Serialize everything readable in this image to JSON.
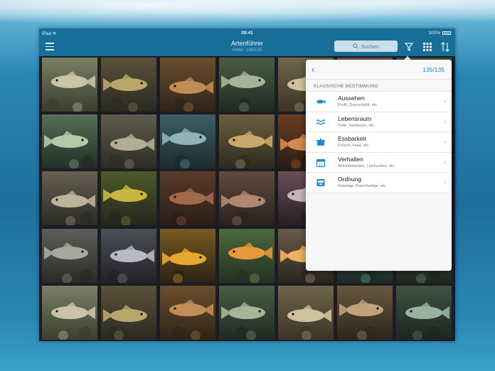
{
  "status_bar": {
    "device": "iPad",
    "time": "09:41",
    "battery": "100%"
  },
  "nav": {
    "title": "Artenführer",
    "subtitle": "Arten: 135/135",
    "search_placeholder": "Suchen",
    "icons": {
      "menu": "hamburger-icon",
      "search": "magnifier-icon",
      "filter": "funnel-icon",
      "grid": "grid-icon",
      "sort": "sort-arrows-icon"
    }
  },
  "popover": {
    "count": "135/135",
    "section_title": "KLASSISCHE BESTIMMUNG",
    "items": [
      {
        "label": "Aussehen",
        "sublabel": "Profil, Querschnitt, etc.",
        "icon": "fish-icon"
      },
      {
        "label": "Lebensraum",
        "sublabel": "Tiefe, Gewässer, etc.",
        "icon": "waves-icon"
      },
      {
        "label": "Essbarkeit",
        "sublabel": "Fleisch, Haut, etc.",
        "icon": "pot-icon"
      },
      {
        "label": "Verhalten",
        "sublabel": "Aktivitätszeiten, Laichzeiten, etc.",
        "icon": "calendar-icon"
      },
      {
        "label": "Ordnung",
        "sublabel": "Aalartige, Barschartige, etc.",
        "icon": "tray-icon"
      }
    ]
  },
  "colors": {
    "bar": "#176f99",
    "accent": "#1b8ad1"
  }
}
